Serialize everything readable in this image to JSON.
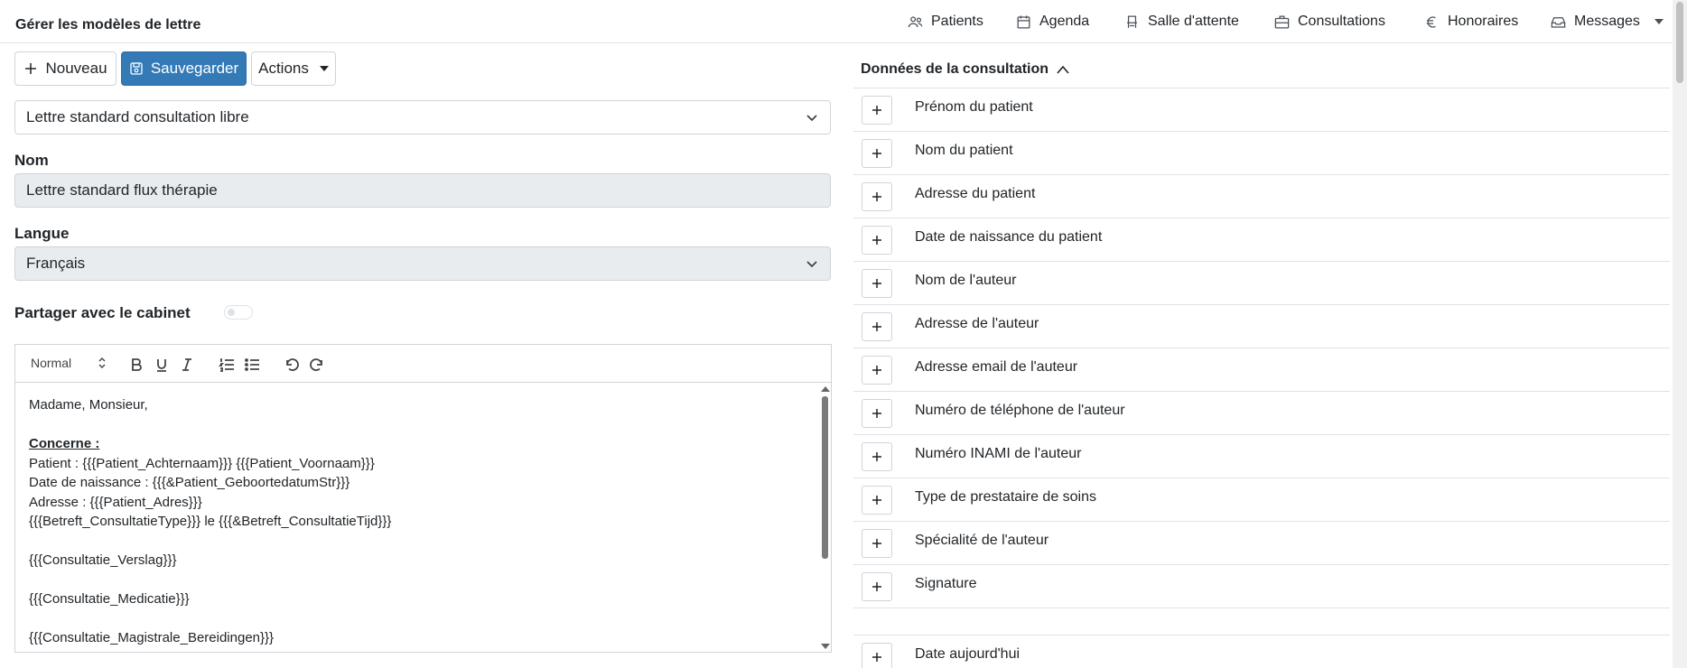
{
  "header": {
    "title": "Gérer les modèles de lettre",
    "nav": [
      {
        "label": "Patients",
        "icon": "users-icon"
      },
      {
        "label": "Agenda",
        "icon": "calendar-icon"
      },
      {
        "label": "Salle d'attente",
        "icon": "chair-icon"
      },
      {
        "label": "Consultations",
        "icon": "briefcase-icon"
      },
      {
        "label": "Honoraires",
        "icon": "euro-icon"
      },
      {
        "label": "Messages",
        "icon": "inbox-icon"
      }
    ]
  },
  "toolbar": {
    "new_label": "Nouveau",
    "save_label": "Sauvegarder",
    "actions_label": "Actions"
  },
  "form": {
    "template_select": "Lettre standard consultation libre",
    "name_label": "Nom",
    "name_value": "Lettre standard flux thérapie",
    "language_label": "Langue",
    "language_value": "Français",
    "share_label": "Partager avec le cabinet"
  },
  "editor": {
    "heading_value": "Normal",
    "lines": [
      "Madame, Monsieur,",
      "",
      "Concerne :",
      "Patient : {{{Patient_Achternaam}}} {{{Patient_Voornaam}}}",
      "Date de naissance : {{{&Patient_GeboortedatumStr}}}",
      "Adresse : {{{Patient_Adres}}}",
      "{{{Betreft_ConsultatieType}}} le {{{&Betreft_ConsultatieTijd}}}",
      "",
      "{{{Consultatie_Verslag}}}",
      "",
      "{{{Consultatie_Medicatie}}}",
      "",
      "{{{Consultatie_Magistrale_Bereidingen}}}"
    ]
  },
  "panel": {
    "title": "Données de la consultation",
    "fields": [
      "Prénom du patient",
      "Nom du patient",
      "Adresse du patient",
      "Date de naissance du patient",
      "Nom de l'auteur",
      "Adresse de l'auteur",
      "Adresse email de l'auteur",
      "Numéro de téléphone de l'auteur",
      "Numéro INAMI de l'auteur",
      "Type de prestataire de soins",
      "Spécialité de l'auteur",
      "Signature"
    ],
    "extra_field": "Date aujourd'hui"
  }
}
